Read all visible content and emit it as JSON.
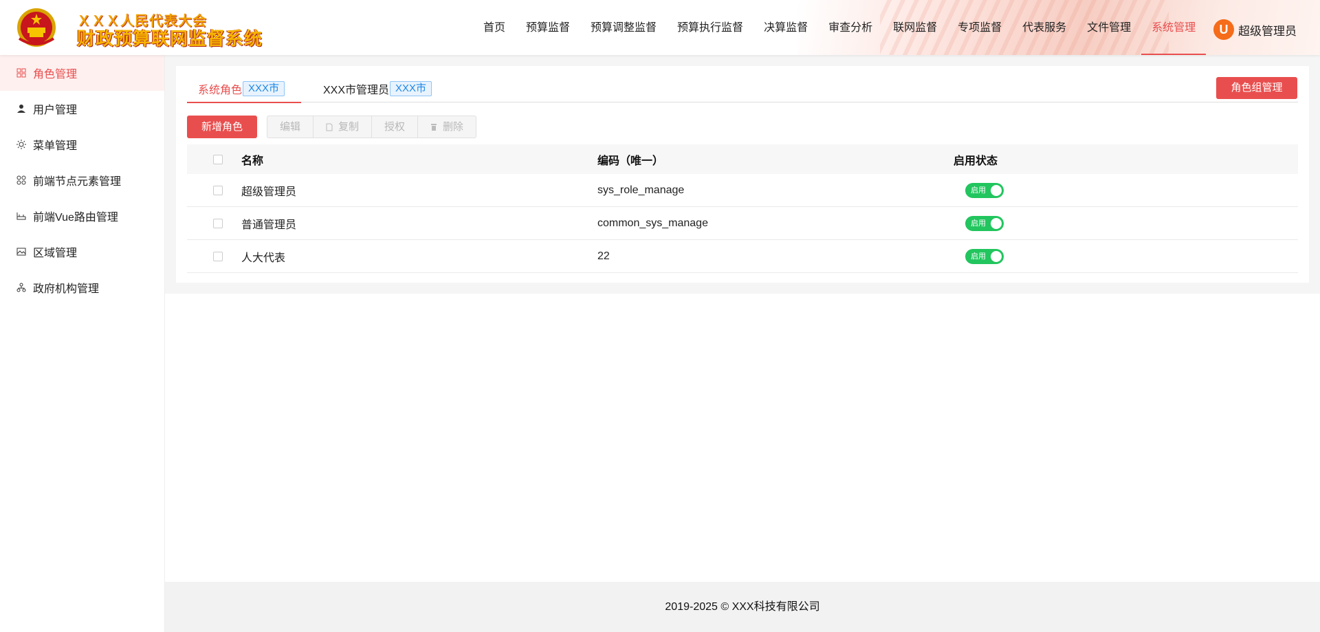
{
  "header": {
    "logo_line1": "ＸＸＸ人民代表大会",
    "logo_line2": "财政预算联网监督系统",
    "nav": [
      {
        "label": "首页",
        "active": false
      },
      {
        "label": "预算监督",
        "active": false
      },
      {
        "label": "预算调整监督",
        "active": false
      },
      {
        "label": "预算执行监督",
        "active": false
      },
      {
        "label": "决算监督",
        "active": false
      },
      {
        "label": "审查分析",
        "active": false
      },
      {
        "label": "联网监督",
        "active": false
      },
      {
        "label": "专项监督",
        "active": false
      },
      {
        "label": "代表服务",
        "active": false
      },
      {
        "label": "文件管理",
        "active": false
      },
      {
        "label": "系统管理",
        "active": true
      }
    ],
    "user": {
      "avatar_letter": "U",
      "name": "超级管理员"
    }
  },
  "sidebar": {
    "items": [
      {
        "label": "角色管理",
        "icon": "grid-icon",
        "active": true
      },
      {
        "label": "用户管理",
        "icon": "user-icon",
        "active": false
      },
      {
        "label": "菜单管理",
        "icon": "sun-icon",
        "active": false
      },
      {
        "label": "前端节点元素管理",
        "icon": "nodes-icon",
        "active": false
      },
      {
        "label": "前端Vue路由管理",
        "icon": "router-icon",
        "active": false
      },
      {
        "label": "区域管理",
        "icon": "map-icon",
        "active": false
      },
      {
        "label": "政府机构管理",
        "icon": "org-icon",
        "active": false
      }
    ]
  },
  "tabs": [
    {
      "label": "系统角色",
      "tag": "XXX市",
      "active": true
    },
    {
      "label": "XXX市管理员",
      "tag": "XXX市",
      "active": false
    }
  ],
  "role_group_button": "角色组管理",
  "toolbar": {
    "add": "新增角色",
    "edit": "编辑",
    "copy": "复制",
    "authorize": "授权",
    "delete": "删除"
  },
  "table": {
    "headers": {
      "name": "名称",
      "code": "编码（唯一）",
      "status": "启用状态"
    },
    "rows": [
      {
        "name": "超级管理员",
        "code": "sys_role_manage",
        "status": "启用"
      },
      {
        "name": "普通管理员",
        "code": "common_sys_manage",
        "status": "启用"
      },
      {
        "name": "人大代表",
        "code": "22",
        "status": "启用"
      }
    ]
  },
  "footer": "2019-2025 © XXX科技有限公司",
  "colors": {
    "accent": "#e94e4e",
    "switch_on": "#22c55e",
    "tag_blue": "#1e88e5",
    "avatar": "#f56c1a"
  }
}
